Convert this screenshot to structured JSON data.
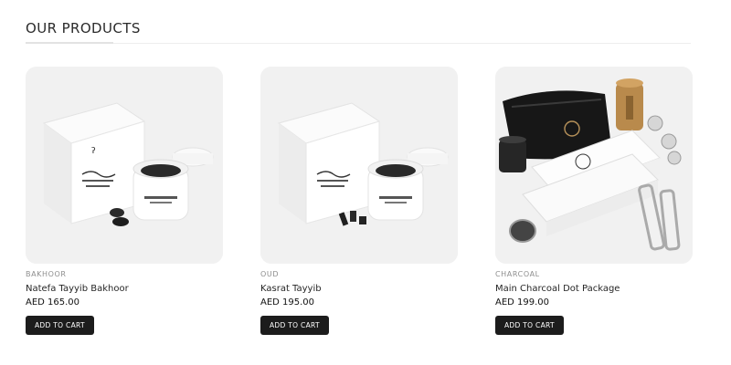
{
  "section": {
    "title": "OUR PRODUCTS"
  },
  "products": [
    {
      "category": "BAKHOOR",
      "name": "Natefa Tayyib Bakhoor",
      "price": "AED 165.00",
      "cta": "ADD TO CART",
      "image_icon": "bakhoor-product-photo"
    },
    {
      "category": "OUD",
      "name": "Kasrat Tayyib",
      "price": "AED 195.00",
      "cta": "ADD TO CART",
      "image_icon": "oud-product-photo"
    },
    {
      "category": "CHARCOAL",
      "name": "Main Charcoal Dot Package",
      "price": "AED 199.00",
      "cta": "ADD TO CART",
      "image_icon": "charcoal-package-photo"
    }
  ],
  "colors": {
    "button_bg": "#1c1c1c",
    "button_text": "#ffffff",
    "category_text": "#8e8e8e",
    "image_bg": "#f1f1f1"
  }
}
